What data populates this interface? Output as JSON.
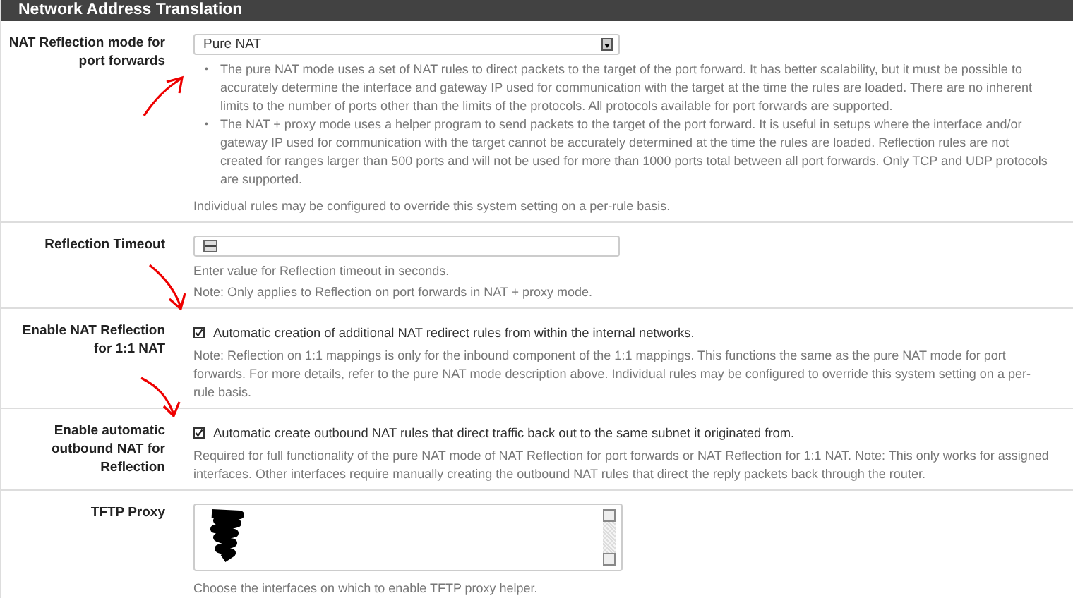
{
  "panel": {
    "title": "Network Address Translation"
  },
  "rows": [
    {
      "kind": "select",
      "label": "NAT Reflection mode for port forwards",
      "value": "Pure NAT",
      "bullets": [
        {
          "marker": "•",
          "text": "The pure NAT mode uses a set of NAT rules to direct packets to the target of the port forward. It has better scalability, but it must be possible to accurately determine the interface and gateway IP used for communication with the target at the time the rules are loaded. There are no inherent limits to the number of ports other than the limits of the protocols. All protocols available for port forwards are supported."
        },
        {
          "marker": "•",
          "text": "The NAT + proxy mode uses a helper program to send packets to the target of the port forward. It is useful in setups where the interface and/or gateway IP used for communication with the target cannot be accurately determined at the time the rules are loaded. Reflection rules are not created for ranges larger than 500 ports and will not be used for more than 1000 ports total between all port forwards. Only TCP and UDP protocols are supported."
        }
      ],
      "help": [
        "Individual rules may be configured to override this system setting on a per-rule basis."
      ]
    },
    {
      "kind": "number",
      "label": "Reflection Timeout",
      "help": [
        "Enter value for Reflection timeout in seconds.",
        "Note: Only applies to Reflection on port forwards in NAT + proxy mode."
      ]
    },
    {
      "kind": "checkbox",
      "label": "Enable NAT Reflection for 1:1 NAT",
      "checked": true,
      "text": "Automatic creation of additional NAT redirect rules from within the internal networks.",
      "help": [
        "Note: Reflection on 1:1 mappings is only for the inbound component of the 1:1 mappings. This functions the same as the pure NAT mode for port forwards. For more details, refer to the pure NAT mode description above. Individual rules may be configured to override this system setting on a per-rule basis."
      ]
    },
    {
      "kind": "checkbox",
      "label": "Enable automatic outbound NAT for Reflection",
      "checked": true,
      "text": "Automatic create outbound NAT rules that direct traffic back out to the same subnet it originated from.",
      "help": [
        "Required for full functionality of the pure NAT mode of NAT Reflection for port forwards or NAT Reflection for 1:1 NAT. Note: This only works for assigned interfaces. Other interfaces require manually creating the outbound NAT rules that direct the reply packets back through the router."
      ]
    },
    {
      "kind": "multiselect",
      "label": "TFTP Proxy",
      "help": [
        "Choose the interfaces on which to enable TFTP proxy helper."
      ]
    }
  ]
}
